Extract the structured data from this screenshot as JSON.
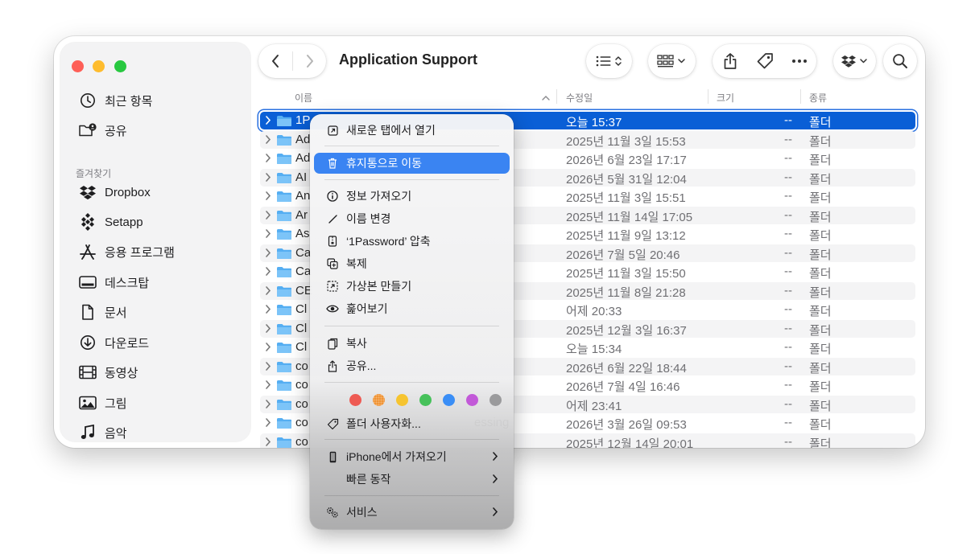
{
  "window": {
    "title": "Application Support"
  },
  "sidebar": {
    "recent": "최근 항목",
    "shared": "공유",
    "favorites_header": "즐겨찾기",
    "items": [
      {
        "label": "Dropbox",
        "icon": "dropbox-icon"
      },
      {
        "label": "Setapp",
        "icon": "setapp-icon"
      },
      {
        "label": "응용 프로그램",
        "icon": "applications-icon"
      },
      {
        "label": "데스크탑",
        "icon": "desktop-icon"
      },
      {
        "label": "문서",
        "icon": "document-icon"
      },
      {
        "label": "다운로드",
        "icon": "download-icon"
      },
      {
        "label": "동영상",
        "icon": "movie-icon"
      },
      {
        "label": "그림",
        "icon": "picture-icon"
      },
      {
        "label": "음악",
        "icon": "music-icon"
      }
    ]
  },
  "toolbar": {
    "back": "back-chevron-icon",
    "forward": "forward-chevron-icon",
    "view_list": "list-view-icon",
    "group": "grid-group-icon",
    "share": "share-icon",
    "tag": "tag-icon",
    "more": "ellipsis-icon",
    "dropbox": "dropbox-icon",
    "search": "search-icon"
  },
  "columns": {
    "name": "이름",
    "modified": "수정일",
    "size": "크기",
    "kind": "종류"
  },
  "files": [
    {
      "name": "1P",
      "date": "오늘 15:37",
      "size": "--",
      "kind": "폴더",
      "selected": true
    },
    {
      "name": "Ad",
      "date": "2025년 11월 3일 15:53",
      "size": "--",
      "kind": "폴더"
    },
    {
      "name": "Ad",
      "date": "2026년 6월 23일 17:17",
      "size": "--",
      "kind": "폴더"
    },
    {
      "name": "AI",
      "date": "2026년 5월 31일 12:04",
      "size": "--",
      "kind": "폴더"
    },
    {
      "name": "An",
      "date": "2025년 11월 3일 15:51",
      "size": "--",
      "kind": "폴더"
    },
    {
      "name": "Ar",
      "date": "2025년 11월 14일 17:05",
      "size": "--",
      "kind": "폴더"
    },
    {
      "name": "As",
      "date": "2025년 11월 9일 13:12",
      "size": "--",
      "kind": "폴더"
    },
    {
      "name": "Ca",
      "date": "2026년 7월 5일 20:46",
      "size": "--",
      "kind": "폴더"
    },
    {
      "name": "Ca",
      "date": "2025년 11월 3일 15:50",
      "size": "--",
      "kind": "폴더"
    },
    {
      "name": "CE",
      "date": "2025년 11월 8일 21:28",
      "size": "--",
      "kind": "폴더"
    },
    {
      "name": "Cl",
      "date": "어제 20:33",
      "size": "--",
      "kind": "폴더"
    },
    {
      "name": "Cl",
      "date": "2025년 12월 3일 16:37",
      "size": "--",
      "kind": "폴더"
    },
    {
      "name": "Cl",
      "date": "오늘 15:34",
      "size": "--",
      "kind": "폴더"
    },
    {
      "name": "co",
      "date": "2026년 6월 22일 18:44",
      "size": "--",
      "kind": "폴더"
    },
    {
      "name": "co",
      "date": "2026년 7월 4일 16:46",
      "size": "--",
      "kind": "폴더"
    },
    {
      "name": "co",
      "date": "어제 23:41",
      "size": "--",
      "kind": "폴더"
    },
    {
      "name": "co",
      "tail": "essing",
      "date": "2026년 3월 26일 09:53",
      "size": "--",
      "kind": "폴더"
    },
    {
      "name": "co",
      "date": "2025년 12월 14일 20:01",
      "size": "--",
      "kind": "폴더"
    }
  ],
  "context_menu": {
    "open_new_tab": "새로운 탭에서 열기",
    "move_to_trash": "휴지통으로 이동",
    "get_info": "정보 가져오기",
    "rename": "이름 변경",
    "compress": "‘1Password’ 압축",
    "duplicate": "복제",
    "make_alias": "가상본 만들기",
    "quick_look": "훑어보기",
    "copy": "복사",
    "share": "공유...",
    "tag_colors": [
      "#ee5a53",
      "#f0912f",
      "#f6c430",
      "#46c15a",
      "#3a8ef6",
      "#c259d8",
      "#9a9a9c"
    ],
    "customize_folder": "폴더 사용자화...",
    "import_from_iphone": "iPhone에서 가져오기",
    "quick_actions": "빠른 동작",
    "services": "서비스"
  }
}
